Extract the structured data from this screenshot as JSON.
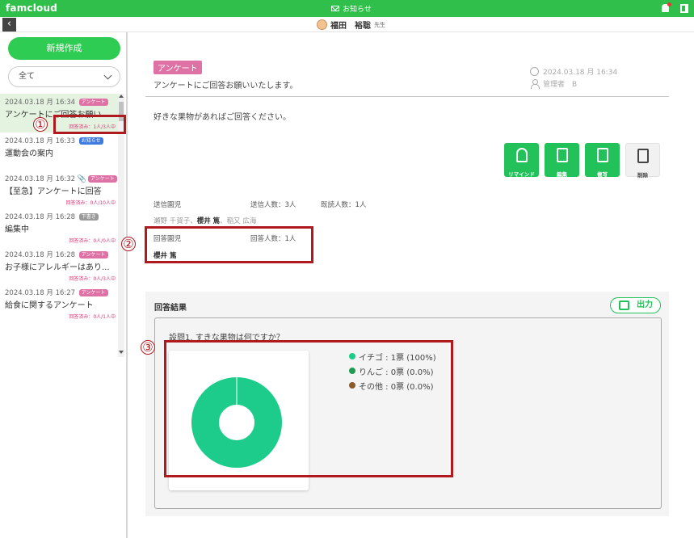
{
  "app": {
    "brand": "famcloud",
    "notice": "お知らせ"
  },
  "user": {
    "name": "福田　裕聡",
    "role": "先生"
  },
  "sidebar": {
    "new_label": "新規作成",
    "filter_value": "全て",
    "items": [
      {
        "date": "2024.03.18 月 16:34",
        "badge": "アンケート",
        "badge_color": "#df72a5",
        "title": "アンケートにご回答お願い...",
        "resp": "回答済み：1人/3人中",
        "clip": false
      },
      {
        "date": "2024.03.18 月 16:33",
        "badge": "お知らせ",
        "badge_color": "#3e7be0",
        "title": "運動会の案内",
        "resp": "",
        "clip": false
      },
      {
        "date": "2024.03.18 月 16:32",
        "badge": "アンケート",
        "badge_color": "#df72a5",
        "title": "【至急】アンケートに回答",
        "resp": "回答済み：0人/10人中",
        "clip": true
      },
      {
        "date": "2024.03.18 月 16:28",
        "badge": "下書き",
        "badge_color": "#9a9a9a",
        "title": "編集中",
        "resp": "回答済み：0人/0人中",
        "clip": false
      },
      {
        "date": "2024.03.18 月 16:28",
        "badge": "アンケート",
        "badge_color": "#df72a5",
        "title": "お子様にアレルギーはあり...",
        "resp": "回答済み：0人/3人中",
        "clip": false
      },
      {
        "date": "2024.03.18 月 16:27",
        "badge": "アンケート",
        "badge_color": "#df72a5",
        "title": "給食に関するアンケート",
        "resp": "回答済み：0人/1人中",
        "clip": false
      }
    ]
  },
  "annotations": {
    "n1": "①",
    "n2": "②",
    "n3": "③"
  },
  "message": {
    "tag": "アンケート",
    "subject": "アンケートにご回答お願いいたします。",
    "datetime": "2024.03.18 月 16:34",
    "author": "管理者　B",
    "body": "好きな果物があればご回答ください。"
  },
  "actions": {
    "remind": "リマインド",
    "edit": "編集",
    "copy": "複写",
    "delete": "削除"
  },
  "recipients": {
    "sent_label": "送信園児",
    "sent_count": "送信人数：3人",
    "read_count": "既読人数：1人",
    "names_pre": "瀬野 千賀子、",
    "names_bold": "櫻井 篤",
    "names_post": "、稲又 広海",
    "answered_label": "回答園児",
    "answered_count": "回答人数：1人",
    "answered_names": "櫻井 篤"
  },
  "results": {
    "title": "回答結果",
    "export_label": "出力",
    "question": "設問1. すきな果物は何ですか？"
  },
  "chart_data": {
    "type": "pie",
    "categories": [
      "イチゴ",
      "りんご",
      "その他"
    ],
    "values": [
      1,
      0,
      0
    ],
    "labels": [
      "イチゴ : 1票 (100%)",
      "りんご : 0票 (0.0%)",
      "その他 : 0票 (0.0%)"
    ],
    "colors": [
      "#1dcb8b",
      "#1e9b4f",
      "#8b5a2b"
    ],
    "title": "",
    "legend": "right"
  }
}
